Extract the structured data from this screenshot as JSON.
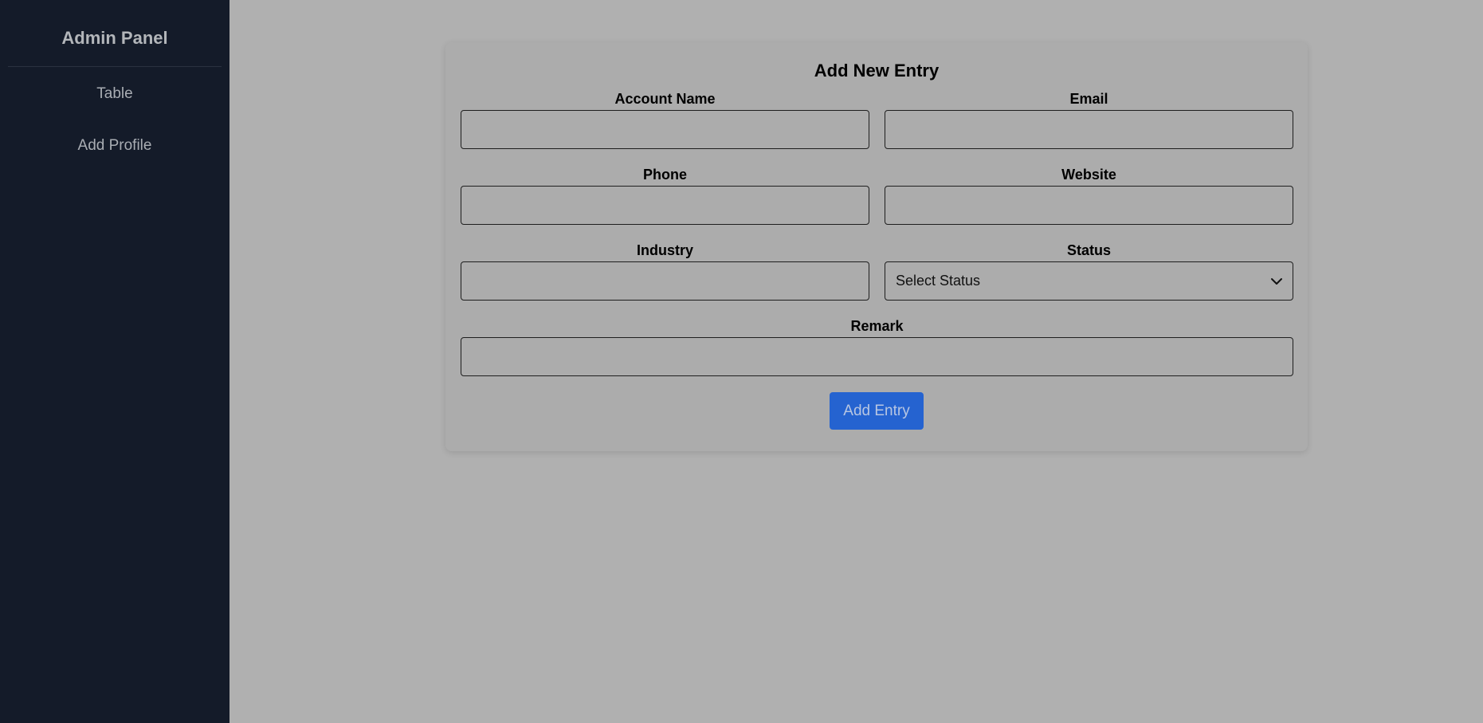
{
  "sidebar": {
    "title": "Admin Panel",
    "items": [
      {
        "label": "Table"
      },
      {
        "label": "Add Profile"
      }
    ]
  },
  "form": {
    "title": "Add New Entry",
    "fields": {
      "account_name": {
        "label": "Account Name",
        "value": "",
        "placeholder": ""
      },
      "email": {
        "label": "Email",
        "value": "",
        "placeholder": ""
      },
      "phone": {
        "label": "Phone",
        "value": "",
        "placeholder": ""
      },
      "website": {
        "label": "Website",
        "value": "",
        "placeholder": ""
      },
      "industry": {
        "label": "Industry",
        "value": "",
        "placeholder": ""
      },
      "status": {
        "label": "Status",
        "selected": "Select Status"
      },
      "remark": {
        "label": "Remark",
        "value": "",
        "placeholder": ""
      }
    },
    "submit_label": "Add Entry"
  },
  "colors": {
    "sidebar_bg": "#141b29",
    "page_bg": "#b0b0b0",
    "button_bg": "#2563d0"
  },
  "icons": {
    "status_dropdown": "chevron-down-icon"
  }
}
